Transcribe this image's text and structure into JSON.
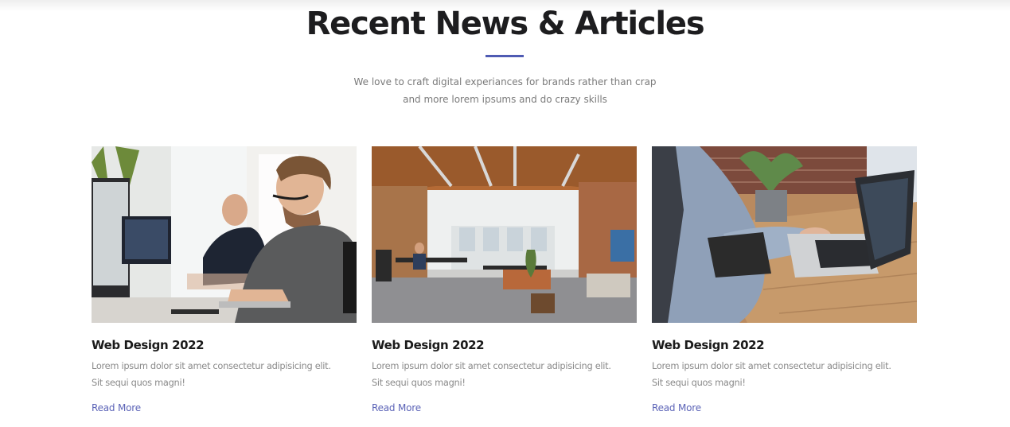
{
  "section": {
    "title": "Recent News & Articles",
    "subtitle_line1": "We love to craft digital experiances for brands rather than crap",
    "subtitle_line2": "and more lorem ipsums and do crazy skills",
    "accent_color": "#4f5bb3"
  },
  "articles": [
    {
      "image": "developers-at-desk-photo",
      "title": "Web Design 2022",
      "excerpt_line1": "Lorem ipsum dolor sit amet consectetur adipisicing elit.",
      "excerpt_line2": "Sit sequi quos magni!",
      "link": "Read More"
    },
    {
      "image": "open-office-photo",
      "title": "Web Design 2022",
      "excerpt_line1": "Lorem ipsum dolor sit amet consectetur adipisicing elit.",
      "excerpt_line2": "Sit sequi quos magni!",
      "link": "Read More"
    },
    {
      "image": "laptop-typing-photo",
      "title": "Web Design 2022",
      "excerpt_line1": "Lorem ipsum dolor sit amet consectetur adipisicing elit.",
      "excerpt_line2": "Sit sequi quos magni!",
      "link": "Read More"
    }
  ]
}
